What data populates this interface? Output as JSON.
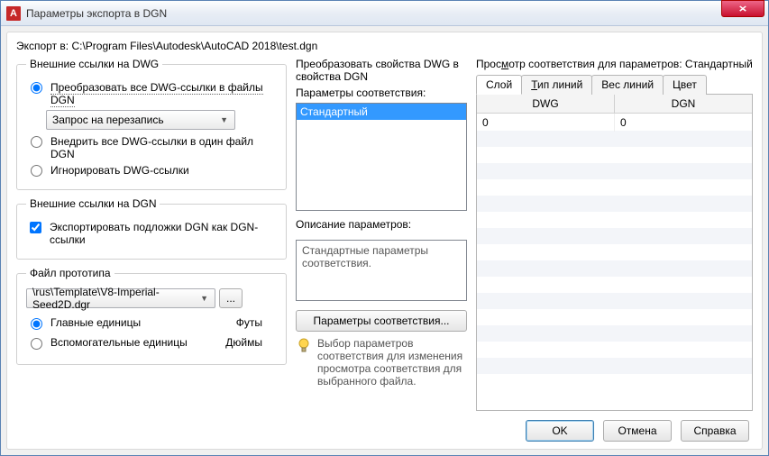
{
  "window": {
    "title": "Параметры экспорта в DGN",
    "app_letter": "A"
  },
  "path": {
    "prefix": "Экспорт в: ",
    "value": "C:\\Program Files\\Autodesk\\AutoCAD 2018\\test.dgn"
  },
  "left": {
    "group_dwg": {
      "legend": "Внешние ссылки на DWG",
      "opt_translate": "Преобразовать все DWG-ссылки в файлы DGN",
      "overwrite_combo": "Запрос на перезапись",
      "opt_bind": "Внедрить все DWG-ссылки в один файл DGN",
      "opt_ignore": "Игнорировать DWG-ссылки"
    },
    "group_dgn": {
      "legend": "Внешние ссылки на DGN",
      "chk_export": "Экспортировать подложки DGN как DGN-ссылки"
    },
    "group_seed": {
      "legend": "Файл прототипа",
      "combo": "\\rus\\Template\\V8-Imperial-Seed2D.dgr",
      "dots": "...",
      "opt_master": "Главные единицы",
      "val_master": "Футы",
      "opt_sub": "Вспомогательные единицы",
      "val_sub": "Дюймы"
    }
  },
  "mid": {
    "section_label": "Преобразовать свойства DWG в свойства DGN",
    "params_label": "Параметры соответствия:",
    "list_item": "Стандартный",
    "desc_label": "Описание параметров:",
    "desc_text": "Стандартные параметры соответствия.",
    "setup_btn": "Параметры соответствия...",
    "hint": "Выбор параметров соответствия для изменения просмотра соответствия для выбранного файла."
  },
  "right": {
    "preview_label": "Просмотр соответствия для параметров: Стандартный",
    "tabs": {
      "layer": "Слой",
      "ltype": "Тип линий",
      "lweight": "Вес линий",
      "color": "Цвет"
    },
    "col_dwg": "DWG",
    "col_dgn": "DGN",
    "row": {
      "dwg": "0",
      "dgn": "0"
    }
  },
  "footer": {
    "ok": "OK",
    "cancel": "Отмена",
    "help": "Справка"
  }
}
